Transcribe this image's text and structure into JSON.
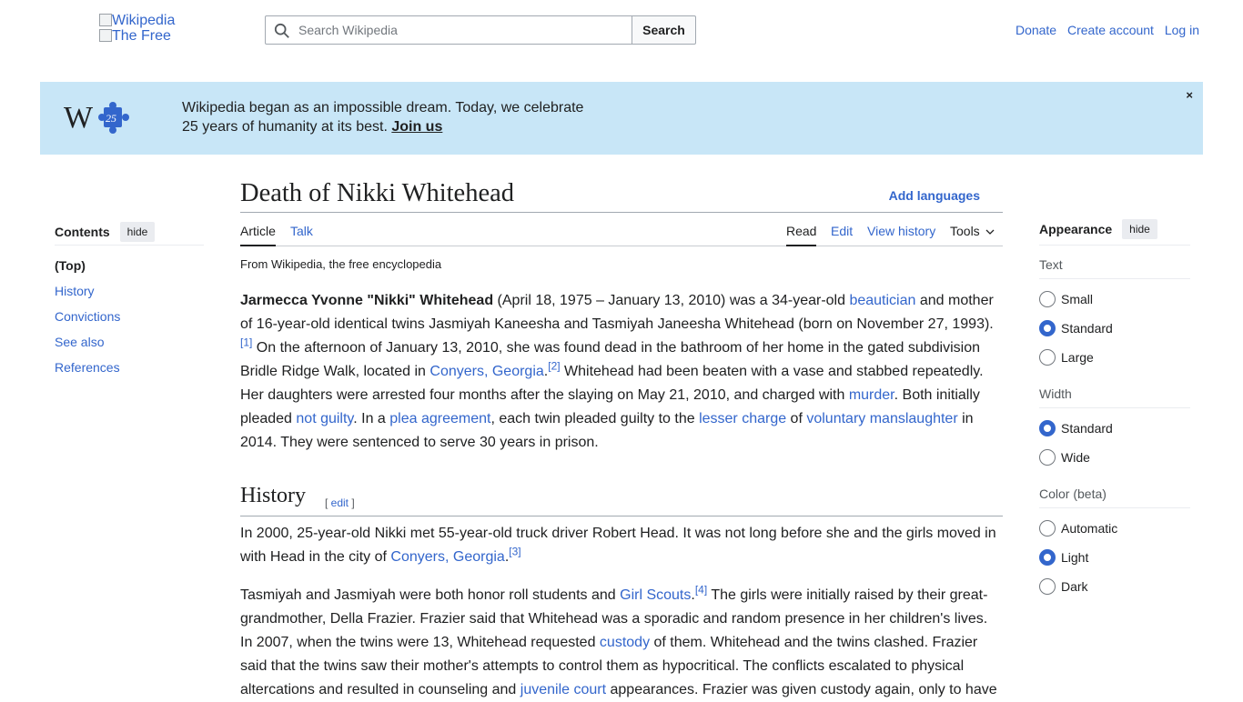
{
  "header": {
    "logo_alt_1": "Wikipedia",
    "logo_alt_2": "The Free",
    "search_placeholder": "Search Wikipedia",
    "search_button": "Search",
    "user_links": [
      "Donate",
      "Create account",
      "Log in"
    ]
  },
  "banner": {
    "line1": "Wikipedia began as an impossible dream. Today, we celebrate",
    "line2": "25 years of humanity at its best.",
    "join": "Join us",
    "close": "×",
    "logo_number": "25"
  },
  "toc": {
    "title": "Contents",
    "hide": "hide",
    "items": [
      "(Top)",
      "History",
      "Convictions",
      "See also",
      "References"
    ]
  },
  "article": {
    "title": "Death of Nikki Whitehead",
    "add_languages": "Add languages",
    "tabs_left": [
      "Article",
      "Talk"
    ],
    "tabs_right": [
      "Read",
      "Edit",
      "View history",
      "Tools"
    ],
    "tagline": "From Wikipedia, the free encyclopedia",
    "lead": {
      "bold": "Jarmecca Yvonne \"Nikki\" Whitehead",
      "t1": " (April 18, 1975 – January 13, 2010) was a 34-year-old ",
      "l_beautician": "beautician",
      "t2": " and mother of 16-year-old identical twins Jasmiyah Kaneesha and Tasmiyah Janeesha Whitehead (born on November 27, 1993).",
      "ref1": "[1]",
      "t3": " On the afternoon of January 13, 2010, she was found dead in the bathroom of her home in the gated subdivision Bridle Ridge Walk, located in ",
      "l_conyers": "Conyers, Georgia",
      "t4": ".",
      "ref2": "[2]",
      "t5": " Whitehead had been beaten with a vase and stabbed repeatedly. Her daughters were arrested four months after the slaying on May 21, 2010, and charged with ",
      "l_murder": "murder",
      "t6": ". Both initially pleaded ",
      "l_notguilty": "not guilty",
      "t7": ". In a ",
      "l_plea": "plea agreement",
      "t8": ", each twin pleaded guilty to the ",
      "l_lesser": "lesser charge",
      "t9": " of ",
      "l_vol": "voluntary manslaughter",
      "t10": " in 2014. They were sentenced to serve 30 years in prison."
    },
    "history": {
      "heading": "History",
      "edit_open": "[ ",
      "edit": "edit",
      "edit_close": " ]",
      "p1_a": "In 2000, 25-year-old Nikki met 55-year-old truck driver Robert Head. It was not long before she and the girls moved in with Head in the city of ",
      "p1_link": "Conyers, Georgia",
      "p1_b": ".",
      "p1_ref": "[3]",
      "p2_a": "Tasmiyah and Jasmiyah were both honor roll students and ",
      "p2_link1": "Girl Scouts",
      "p2_b": ".",
      "p2_ref": "[4]",
      "p2_c": " The girls were initially raised by their great-grandmother, Della Frazier. Frazier said that Whitehead was a sporadic and random presence in her children's lives. In 2007, when the twins were 13, Whitehead requested ",
      "p2_link2": "custody",
      "p2_d": " of them. Whitehead and the twins clashed. Frazier said that the twins saw their mother's attempts to control them as hypocritical. The conflicts escalated to physical altercations and resulted in counseling and ",
      "p2_link3": "juvenile court",
      "p2_e": " appearances. Frazier was given custody again, only to have"
    }
  },
  "appearance": {
    "title": "Appearance",
    "hide": "hide",
    "groups": [
      {
        "label": "Text",
        "options": [
          "Small",
          "Standard",
          "Large"
        ],
        "selected": "Standard"
      },
      {
        "label": "Width",
        "options": [
          "Standard",
          "Wide"
        ],
        "selected": "Standard"
      },
      {
        "label": "Color (beta)",
        "options": [
          "Automatic",
          "Light",
          "Dark"
        ],
        "selected": "Light"
      }
    ]
  },
  "colors": {
    "link": "#3366cc",
    "banner_bg": "#c8e6f7",
    "text": "#202122"
  }
}
